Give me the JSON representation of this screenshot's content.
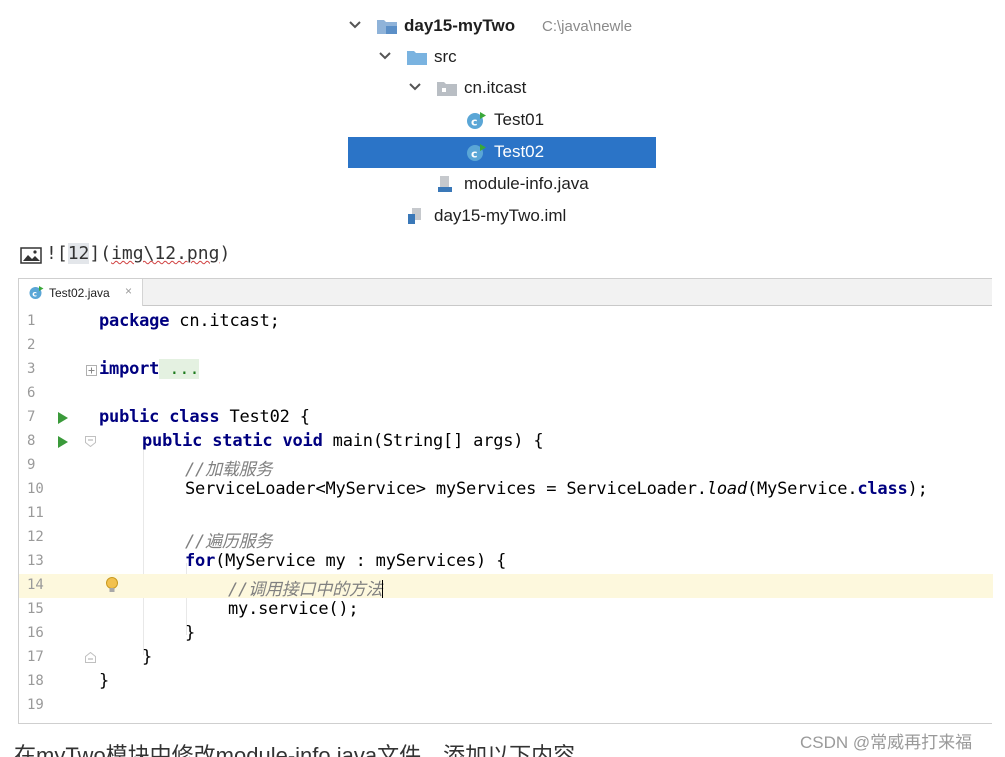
{
  "tree": {
    "items": [
      {
        "label": "day15-myTwo",
        "path": "C:\\java\\newle"
      },
      {
        "label": "src"
      },
      {
        "label": "cn.itcast"
      },
      {
        "label": "Test01"
      },
      {
        "label": "Test02"
      },
      {
        "label": "module-info.java"
      },
      {
        "label": "day15-myTwo.iml"
      }
    ]
  },
  "markdown": {
    "prefix": "![",
    "alt": "12",
    "mid": "](",
    "path": "img\\12.png",
    "suffix": ")"
  },
  "editor": {
    "tab_label": "Test02.java",
    "tab_close": "×",
    "line_numbers": [
      "1",
      "2",
      "3",
      "6",
      "7",
      "8",
      "9",
      "10",
      "11",
      "12",
      "13",
      "14",
      "15",
      "16",
      "17",
      "18",
      "19"
    ],
    "code": {
      "l1_kw": "package",
      "l1_rest": " cn.itcast;",
      "l3_kw": "import",
      "l3_fold": " ...",
      "l7_kw": "public class",
      "l7_rest": " Test02 {",
      "l8_kw": "public static void",
      "l8_rest": " main(String[] args) {",
      "l9_cmt": "//加载服务",
      "l10_a": "ServiceLoader<MyService> myServices = ServiceLoader.",
      "l10_load": "load",
      "l10_b": "(MyService.",
      "l10_class": "class",
      "l10_c": ");",
      "l12_cmt": "//遍历服务",
      "l13_kw": "for",
      "l13_rest": "(MyService my : myServices) {",
      "l14_cmt": "//调用接口中的方法",
      "l15": "my.service();",
      "l16": "}",
      "l17": "}",
      "l18": "}"
    }
  },
  "bottom_text": "在myTwo模块中修改module-info.java文件，添加以下内容",
  "watermark": "CSDN @常威再打来福",
  "colors": {
    "selection": "#2b74c7",
    "keyword": "#000080",
    "comment": "#808080",
    "current_line": "#fdf8dd",
    "run_green": "#3a9a3a"
  }
}
